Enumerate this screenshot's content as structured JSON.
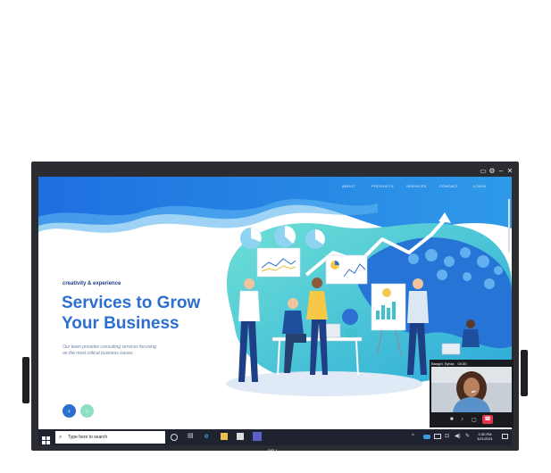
{
  "nav": {
    "items": [
      "ABOUT",
      "PRODUCTS",
      "SERVICES",
      "CONTACT",
      "LOGIN"
    ]
  },
  "hero": {
    "tagline": "creativity & experience",
    "title_line1": "Services to Grow",
    "title_line2": "Your Business",
    "description_line1": "Our team provides consulting services focusing",
    "description_line2": "on the most critical business issues."
  },
  "carousel": {
    "prev_icon": "chevron-left-icon",
    "next_icon": "chevron-right-icon"
  },
  "taskbar": {
    "search_placeholder": "Type here to search",
    "time": "2:30 PM",
    "date": "3/21/2021"
  },
  "video_call": {
    "caller": "Bangel, Sylvia",
    "duration": "04:30"
  },
  "monitor": {
    "brand": "DELL"
  },
  "colors": {
    "brand_blue": "#2c6fd1",
    "wave_blue": "#1c84e0",
    "wave_teal": "#3fc1cf",
    "taskbar": "#1f2330",
    "hangup_red": "#e0354b"
  }
}
